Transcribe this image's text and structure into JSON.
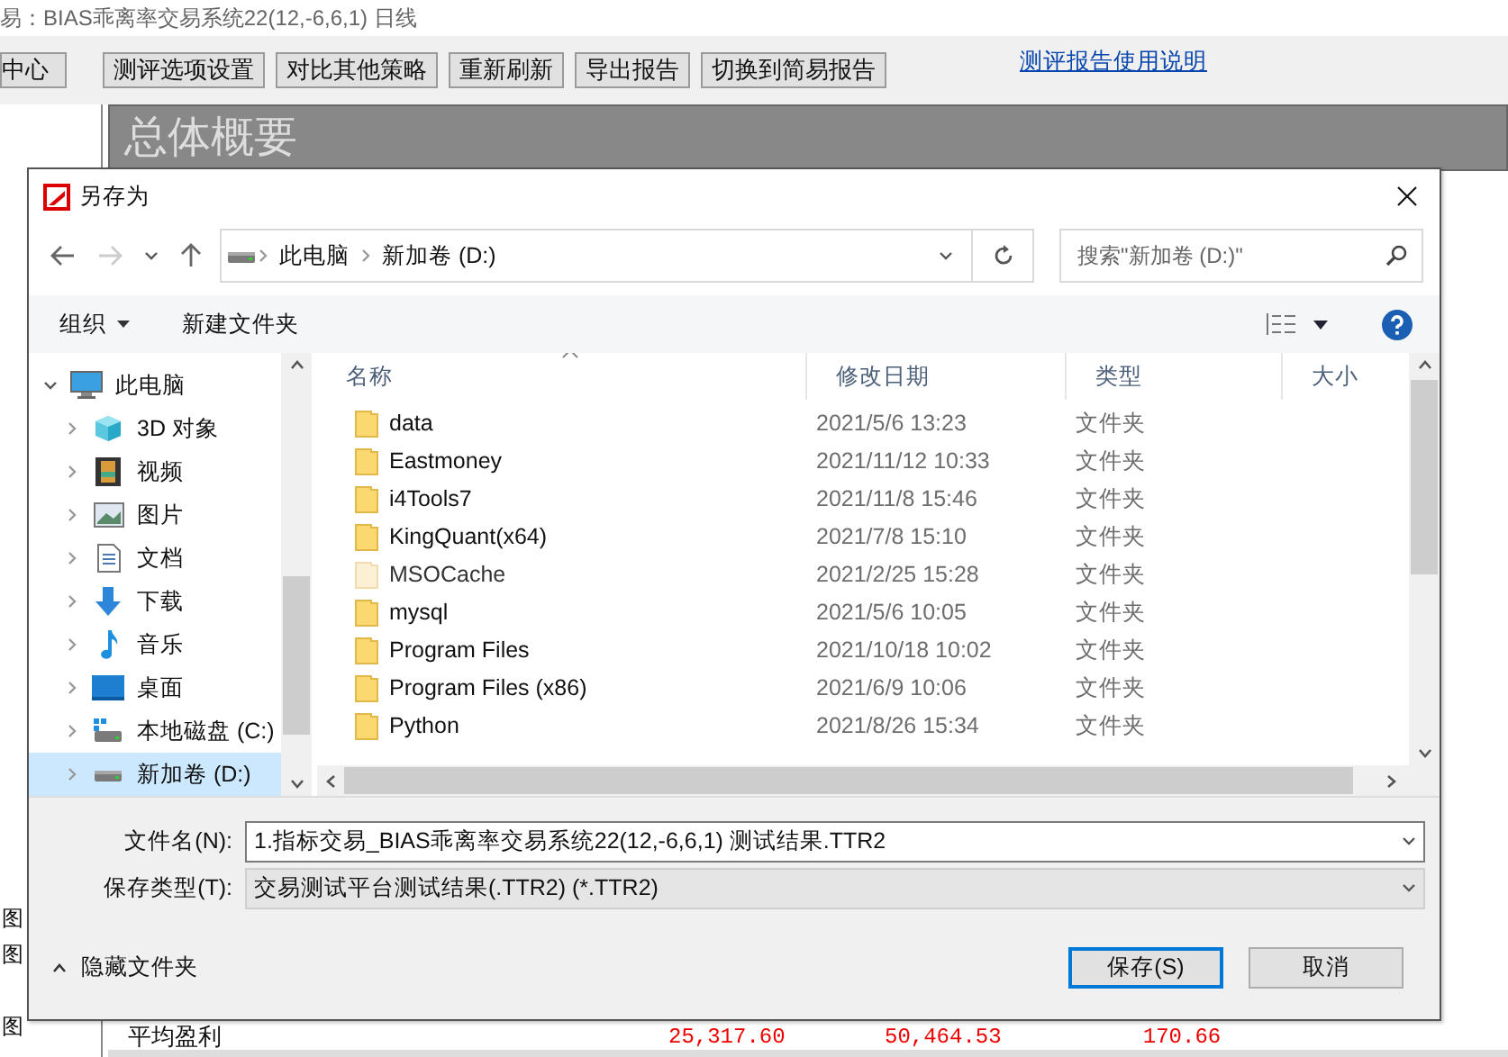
{
  "app": {
    "title": "易：BIAS乖离率交易系统22(12,-6,6,1) 日线",
    "toolbar": [
      "中心",
      "测评选项设置",
      "对比其他策略",
      "重新刷新",
      "导出报告",
      "切换到简易报告"
    ],
    "help_link": "测评报告使用说明",
    "section_title": "总体概要",
    "side_marks": [
      "图",
      "图",
      "图"
    ],
    "summary_row": {
      "label": "平均盈利",
      "values": [
        "25,317.60",
        "50,464.53",
        "170.66"
      ]
    }
  },
  "dialog": {
    "title": "另存为",
    "address": [
      "此电脑",
      "新加卷 (D:)"
    ],
    "search": {
      "placeholder": "搜索\"新加卷 (D:)\""
    },
    "organize": "组织",
    "new_folder": "新建文件夹",
    "nav": [
      {
        "label": "此电脑",
        "kind": "pc",
        "expanded": true,
        "selected": false,
        "children": [
          {
            "label": "3D 对象",
            "kind": "cube",
            "expanded": false,
            "selected": false
          },
          {
            "label": "视频",
            "kind": "video",
            "expanded": false,
            "selected": false
          },
          {
            "label": "图片",
            "kind": "picture",
            "expanded": false,
            "selected": false
          },
          {
            "label": "文档",
            "kind": "document",
            "expanded": false,
            "selected": false
          },
          {
            "label": "下载",
            "kind": "download",
            "expanded": false,
            "selected": false
          },
          {
            "label": "音乐",
            "kind": "music",
            "expanded": false,
            "selected": false
          },
          {
            "label": "桌面",
            "kind": "desktop",
            "expanded": false,
            "selected": false
          },
          {
            "label": "本地磁盘 (C:)",
            "kind": "system",
            "expanded": false,
            "selected": false
          },
          {
            "label": "新加卷 (D:)",
            "kind": "drive",
            "expanded": false,
            "selected": true
          }
        ]
      }
    ],
    "columns": [
      "名称",
      "修改日期",
      "类型",
      "大小"
    ],
    "rows": [
      {
        "name": "data",
        "date": "2021/5/6 13:23",
        "type": "文件夹",
        "hidden": false
      },
      {
        "name": "Eastmoney",
        "date": "2021/11/12 10:33",
        "type": "文件夹",
        "hidden": false
      },
      {
        "name": "i4Tools7",
        "date": "2021/11/8 15:46",
        "type": "文件夹",
        "hidden": false
      },
      {
        "name": "KingQuant(x64)",
        "date": "2021/7/8 15:10",
        "type": "文件夹",
        "hidden": false
      },
      {
        "name": "MSOCache",
        "date": "2021/2/25 15:28",
        "type": "文件夹",
        "hidden": true
      },
      {
        "name": "mysql",
        "date": "2021/5/6 10:05",
        "type": "文件夹",
        "hidden": false
      },
      {
        "name": "Program Files",
        "date": "2021/10/18 10:02",
        "type": "文件夹",
        "hidden": false
      },
      {
        "name": "Program Files (x86)",
        "date": "2021/6/9 10:06",
        "type": "文件夹",
        "hidden": false
      },
      {
        "name": "Python",
        "date": "2021/8/26 15:34",
        "type": "文件夹",
        "hidden": false
      }
    ],
    "filename": {
      "label": "文件名(N):",
      "value": "1.指标交易_BIAS乖离率交易系统22(12,-6,6,1) 测试结果.TTR2"
    },
    "filetype": {
      "label": "保存类型(T):",
      "value": "交易测试平台测试结果(.TTR2) (*.TTR2)"
    },
    "hide_folders": "隐藏文件夹",
    "buttons": [
      {
        "label": "保存(S)",
        "primary": true
      },
      {
        "label": "取消",
        "primary": false
      }
    ]
  }
}
